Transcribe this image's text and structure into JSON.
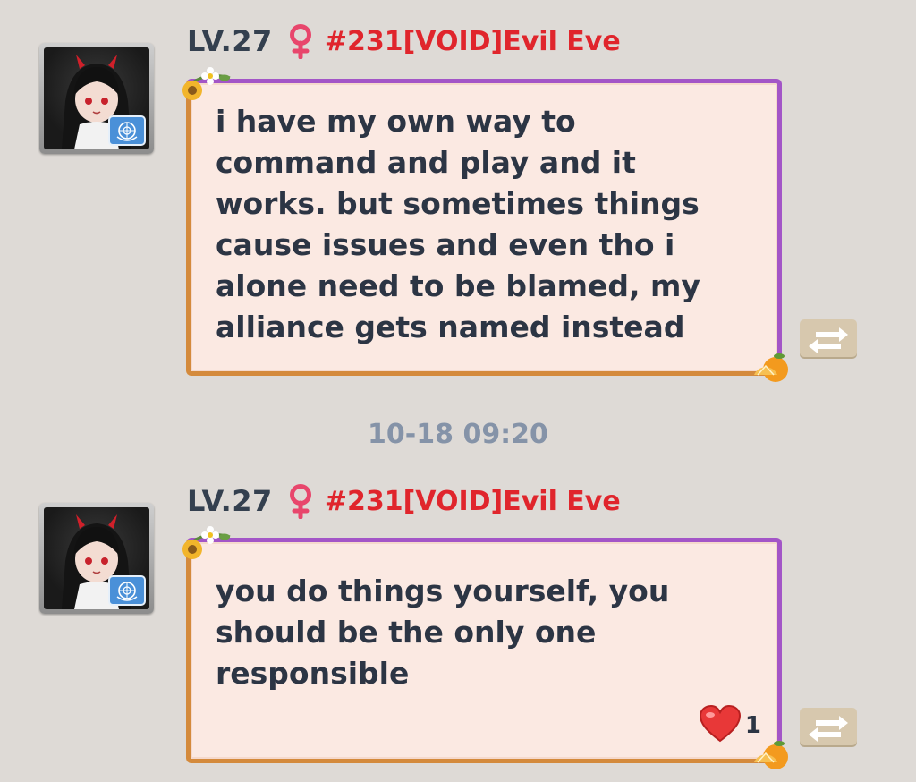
{
  "messages": [
    {
      "level": "LV.27",
      "name": "#231[VOID]Evil Eve",
      "text": "i have my own way to\ncommand and play and it\nworks. but sometimes things\ncause issues and even tho i\nalone need to be blamed, my\nalliance gets named instead",
      "icons": {
        "avatar": "avatar-portrait",
        "badge": "un-flag-icon",
        "gender": "female-icon",
        "share": "swap-arrows-icon"
      }
    },
    {
      "level": "LV.27",
      "name": "#231[VOID]Evil Eve",
      "text": "you do things yourself, you\nshould be the only one\nresponsible",
      "reaction": {
        "icon": "heart-icon",
        "count": "1"
      },
      "icons": {
        "avatar": "avatar-portrait",
        "badge": "un-flag-icon",
        "gender": "female-icon",
        "share": "swap-arrows-icon"
      }
    }
  ],
  "timestamp": "10-18 09:20",
  "colors": {
    "background": "#dedad6",
    "name": "#e0252c",
    "level": "#34404f",
    "bubble_fill": "#fbe9e2",
    "bubble_border_top": "#a355c7",
    "bubble_border_bottom": "#d48a3c",
    "timestamp": "#8593a8"
  }
}
